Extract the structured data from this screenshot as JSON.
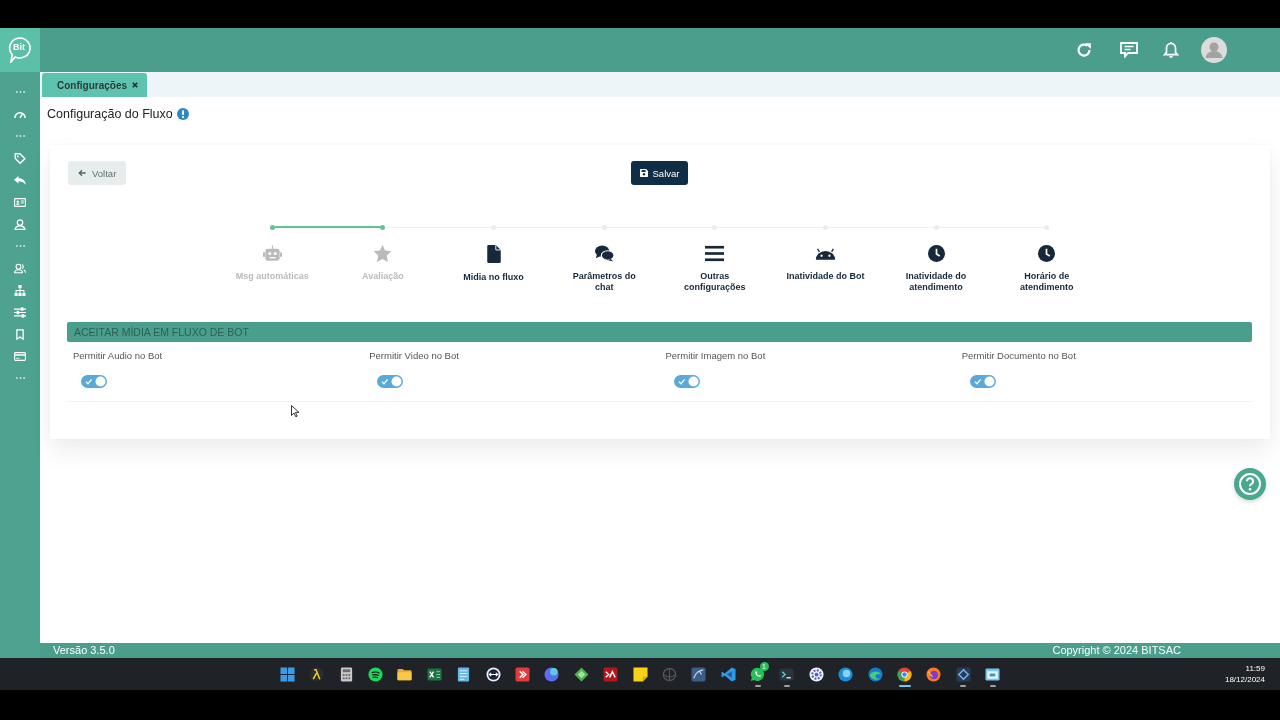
{
  "brand": {
    "logo_text": "Bit"
  },
  "tabs": [
    {
      "label": "Configurações",
      "selected": true
    }
  ],
  "page": {
    "title": "Configuração do Fluxo",
    "back_button": "Voltar",
    "save_button": "Salvar"
  },
  "steps": [
    {
      "label": "Msg automáticas",
      "done": true
    },
    {
      "label": "Avaliação",
      "done": true
    },
    {
      "label": "Midia no fluxo",
      "done": false
    },
    {
      "label": "Parâmetros do chat",
      "done": false
    },
    {
      "label": "Outras configurações",
      "done": false
    },
    {
      "label": "Inatividade do Bot",
      "done": false
    },
    {
      "label": "Inatividade do atendimento",
      "done": false
    },
    {
      "label": "Horário de atendimento",
      "done": false
    }
  ],
  "section": {
    "title": "ACEITAR MÍDIA EM FLUXO DE BOT",
    "toggles": [
      {
        "label": "Permitir Audio no Bot",
        "on": true
      },
      {
        "label": "Permitir Video no Bot",
        "on": true
      },
      {
        "label": "Permitir Imagem no Bot",
        "on": true
      },
      {
        "label": "Permitir Documento no Bot",
        "on": true
      }
    ]
  },
  "footer": {
    "version": "Versão 3.5.0",
    "copyright": "Copyright © 2024 BITSAC"
  },
  "taskbar": {
    "apps": [
      {
        "running": false,
        "selected": false
      },
      {
        "running": false,
        "selected": false
      },
      {
        "running": false,
        "selected": false
      },
      {
        "running": false,
        "selected": false
      },
      {
        "running": false,
        "selected": false
      },
      {
        "running": false,
        "selected": false
      },
      {
        "running": false,
        "selected": false
      },
      {
        "running": false,
        "selected": false
      },
      {
        "running": false,
        "selected": false
      },
      {
        "running": false,
        "selected": false
      },
      {
        "running": false,
        "selected": false
      },
      {
        "running": false,
        "selected": false
      },
      {
        "running": false,
        "selected": false
      },
      {
        "running": false,
        "selected": false
      },
      {
        "running": false,
        "selected": false
      },
      {
        "running": false,
        "selected": false
      },
      {
        "running": true,
        "selected": false,
        "badge": "1"
      },
      {
        "running": true,
        "selected": false
      },
      {
        "running": false,
        "selected": false
      },
      {
        "running": false,
        "selected": false
      },
      {
        "running": false,
        "selected": false
      },
      {
        "running": true,
        "selected": true
      },
      {
        "running": false,
        "selected": false
      },
      {
        "running": true,
        "selected": false
      },
      {
        "running": true,
        "selected": false
      }
    ],
    "time": "11:59",
    "date": "18/12/2024"
  }
}
